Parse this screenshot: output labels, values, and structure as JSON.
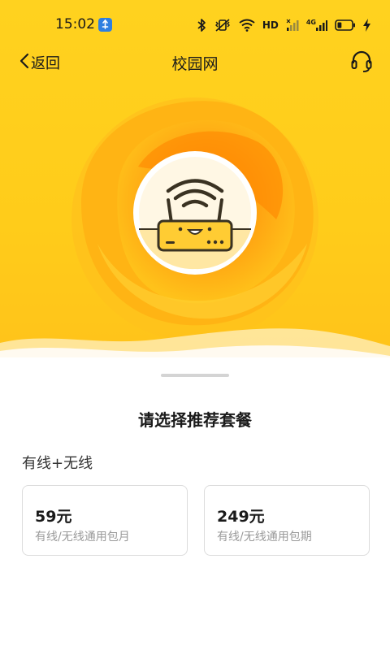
{
  "status_bar": {
    "time": "15:02",
    "hd_label": "HD",
    "network_label": "4G",
    "icons": [
      "notification-app-icon",
      "bluetooth-icon",
      "vibrate-icon",
      "wifi-icon",
      "hd-icon",
      "signal-icon",
      "signal-4g-icon",
      "battery-icon",
      "charging-icon"
    ],
    "battery_level": 0.3
  },
  "nav": {
    "back_label": "返回",
    "title": "校园网",
    "support_icon": "headset-icon"
  },
  "hero": {
    "colors": {
      "background": "#ffd21f",
      "sun_outer": "#ffc21a",
      "sun_inner": "#ff9a0a",
      "router_body": "#ffcc33"
    },
    "illustration_icon": "router-wifi-icon"
  },
  "sheet": {
    "title": "请选择推荐套餐",
    "section_label": "有线+无线",
    "plans": [
      {
        "price": "59元",
        "description": "有线/无线通用包月"
      },
      {
        "price": "249元",
        "description": "有线/无线通用包期"
      }
    ]
  }
}
